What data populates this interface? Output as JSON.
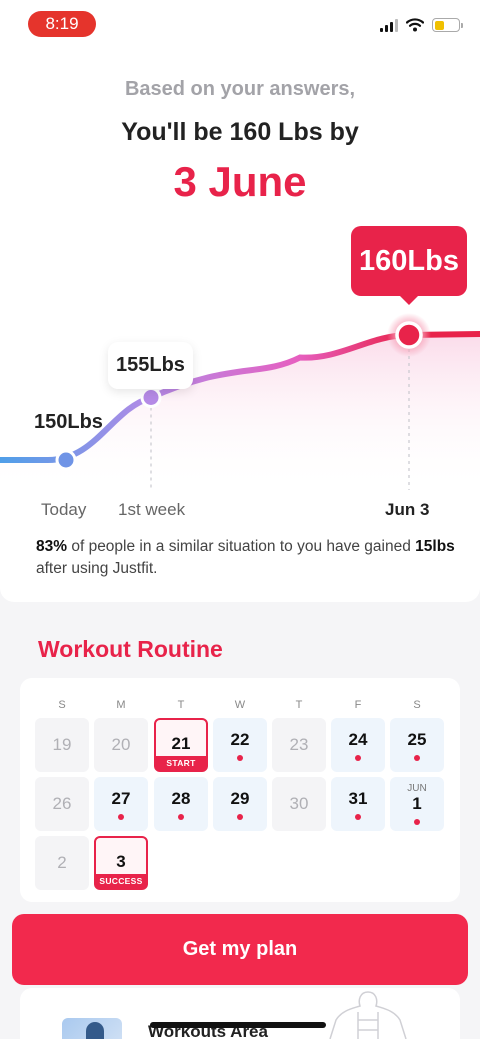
{
  "status_bar": {
    "time": "8:19",
    "battery_level": 0.42
  },
  "header": {
    "subtitle": "Based on your answers,",
    "headline": "You'll be 160 Lbs by",
    "target_date": "3 June"
  },
  "chart_data": {
    "type": "line",
    "x": [
      "Today",
      "1st week",
      "Jun 3"
    ],
    "values": [
      150,
      155,
      160
    ],
    "point_labels": [
      "150Lbs",
      "155Lbs",
      "160Lbs"
    ],
    "unit": "Lbs",
    "colors": {
      "start": "#4f9fe8",
      "mid": "#b58ae6",
      "end": "#e8234a"
    }
  },
  "stat": {
    "percent": "83%",
    "text_1": " of people in a similar situation to you have gained ",
    "amount": "15lbs",
    "text_2": " after using Justfit."
  },
  "routine": {
    "title": "Workout Routine",
    "weekdays": [
      "S",
      "M",
      "T",
      "W",
      "T",
      "F",
      "S"
    ],
    "rows": [
      [
        {
          "day": "19",
          "state": "past"
        },
        {
          "day": "20",
          "state": "past"
        },
        {
          "day": "21",
          "state": "mark",
          "tag": "START"
        },
        {
          "day": "22",
          "state": "plan"
        },
        {
          "day": "23",
          "state": "past"
        },
        {
          "day": "24",
          "state": "plan"
        },
        {
          "day": "25",
          "state": "plan"
        }
      ],
      [
        {
          "day": "26",
          "state": "past"
        },
        {
          "day": "27",
          "state": "plan"
        },
        {
          "day": "28",
          "state": "plan"
        },
        {
          "day": "29",
          "state": "plan"
        },
        {
          "day": "30",
          "state": "past"
        },
        {
          "day": "31",
          "state": "plan"
        },
        {
          "day": "1",
          "state": "plan",
          "month": "JUN"
        }
      ],
      [
        {
          "day": "2",
          "state": "past"
        },
        {
          "day": "3",
          "state": "mark",
          "tag": "SUCCESS"
        }
      ]
    ]
  },
  "cta": {
    "label": "Get my plan"
  },
  "bottom": {
    "areas_label": "Workouts Area"
  },
  "colors": {
    "accent": "#e8234a",
    "button": "#f2294d"
  }
}
